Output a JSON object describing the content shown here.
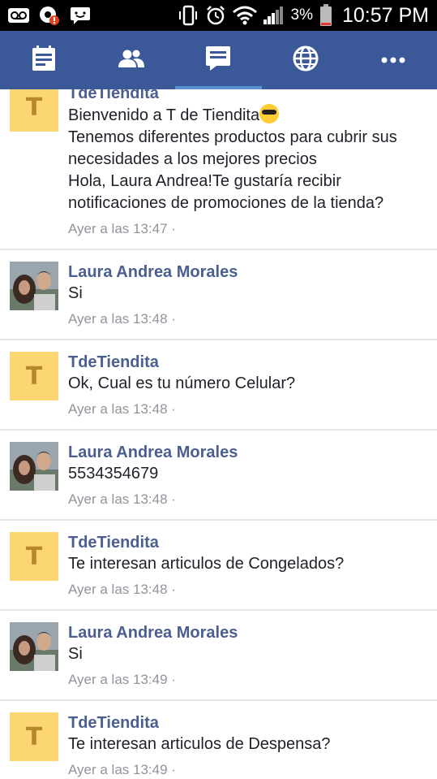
{
  "status_bar": {
    "icons": [
      "voicemail-icon",
      "alert-app-icon",
      "chat-notification-icon",
      "vibrate-icon",
      "alarm-icon",
      "wifi-icon",
      "signal-icon",
      "battery-icon"
    ],
    "battery_percent": "3%",
    "time": "10:57 PM"
  },
  "nav": {
    "tabs": [
      {
        "name": "feed",
        "icon": "news-feed-icon",
        "active": false
      },
      {
        "name": "friends",
        "icon": "friends-icon",
        "active": false
      },
      {
        "name": "messages",
        "icon": "messages-icon",
        "active": true
      },
      {
        "name": "notifications",
        "icon": "globe-icon",
        "active": false
      },
      {
        "name": "more",
        "icon": "more-icon",
        "active": false
      }
    ],
    "color": "#3b5998"
  },
  "messages": [
    {
      "sender": "TdeTiendita",
      "avatar_letter": "T",
      "text": "Bienvenido a T de Tiendita",
      "text2": "Tenemos diferentes productos para cubrir sus necesidades a los mejores precios\n  Hola, Laura Andrea!Te gustaría recibir notificaciones de promociones de la tienda?",
      "time": "Ayer a las 13:47 ·"
    },
    {
      "sender": "Laura Andrea Morales",
      "text": "Si",
      "time": "Ayer a las 13:48 ·"
    },
    {
      "sender": "TdeTiendita",
      "avatar_letter": "T",
      "text": "Ok, Cual es tu número Celular?",
      "time": "Ayer a las 13:48 ·"
    },
    {
      "sender": "Laura Andrea Morales",
      "text": "5534354679",
      "time": "Ayer a las 13:48 ·"
    },
    {
      "sender": "TdeTiendita",
      "avatar_letter": "T",
      "text": "Te interesan articulos de Congelados?",
      "time": "Ayer a las 13:48 ·"
    },
    {
      "sender": "Laura Andrea Morales",
      "text": "Si",
      "time": "Ayer a las 13:49 ·"
    },
    {
      "sender": "TdeTiendita",
      "avatar_letter": "T",
      "text": "Te interesan articulos de Despensa?",
      "time": "Ayer a las 13:49 ·"
    }
  ]
}
